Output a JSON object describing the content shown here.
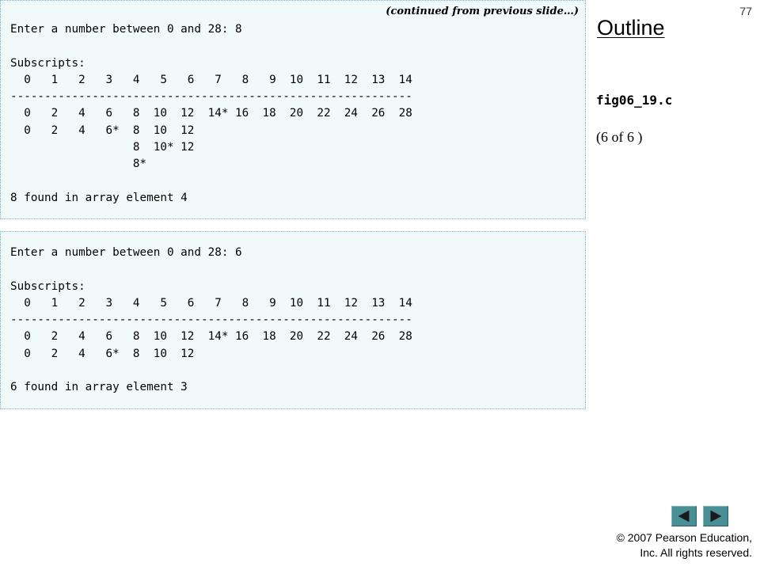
{
  "slide": {
    "number": "77",
    "continued_note": "(continued from previous slide…)"
  },
  "outline": {
    "title": "Outline",
    "file_name": "fig06_19.c",
    "page_indicator": "(6 of 6 )"
  },
  "outputs": [
    {
      "lines": [
        "Enter a number between 0 and 28: 8",
        "",
        "Subscripts:",
        "  0   1   2   3   4   5   6   7   8   9  10  11  12  13  14",
        "-----------------------------------------------------------",
        "  0   2   4   6   8  10  12  14* 16  18  20  22  24  26  28",
        "  0   2   4   6*  8  10  12",
        "                  8  10* 12",
        "                  8*",
        "",
        "8 found in array element 4"
      ]
    },
    {
      "lines": [
        "Enter a number between 0 and 28: 6",
        "",
        "Subscripts:",
        "  0   1   2   3   4   5   6   7   8   9  10  11  12  13  14",
        "-----------------------------------------------------------",
        "  0   2   4   6   8  10  12  14* 16  18  20  22  24  26  28",
        "  0   2   4   6*  8  10  12",
        "",
        "6 found in array element 3"
      ]
    }
  ],
  "navigation": {
    "prev_icon": "triangle-left-icon",
    "next_icon": "triangle-right-icon",
    "icon_color": "#1a1a1a",
    "button_color": "#4a8e96"
  },
  "footer": {
    "copyright_line1": "© 2007 Pearson Education,",
    "copyright_line2": "Inc.  All rights reserved."
  }
}
